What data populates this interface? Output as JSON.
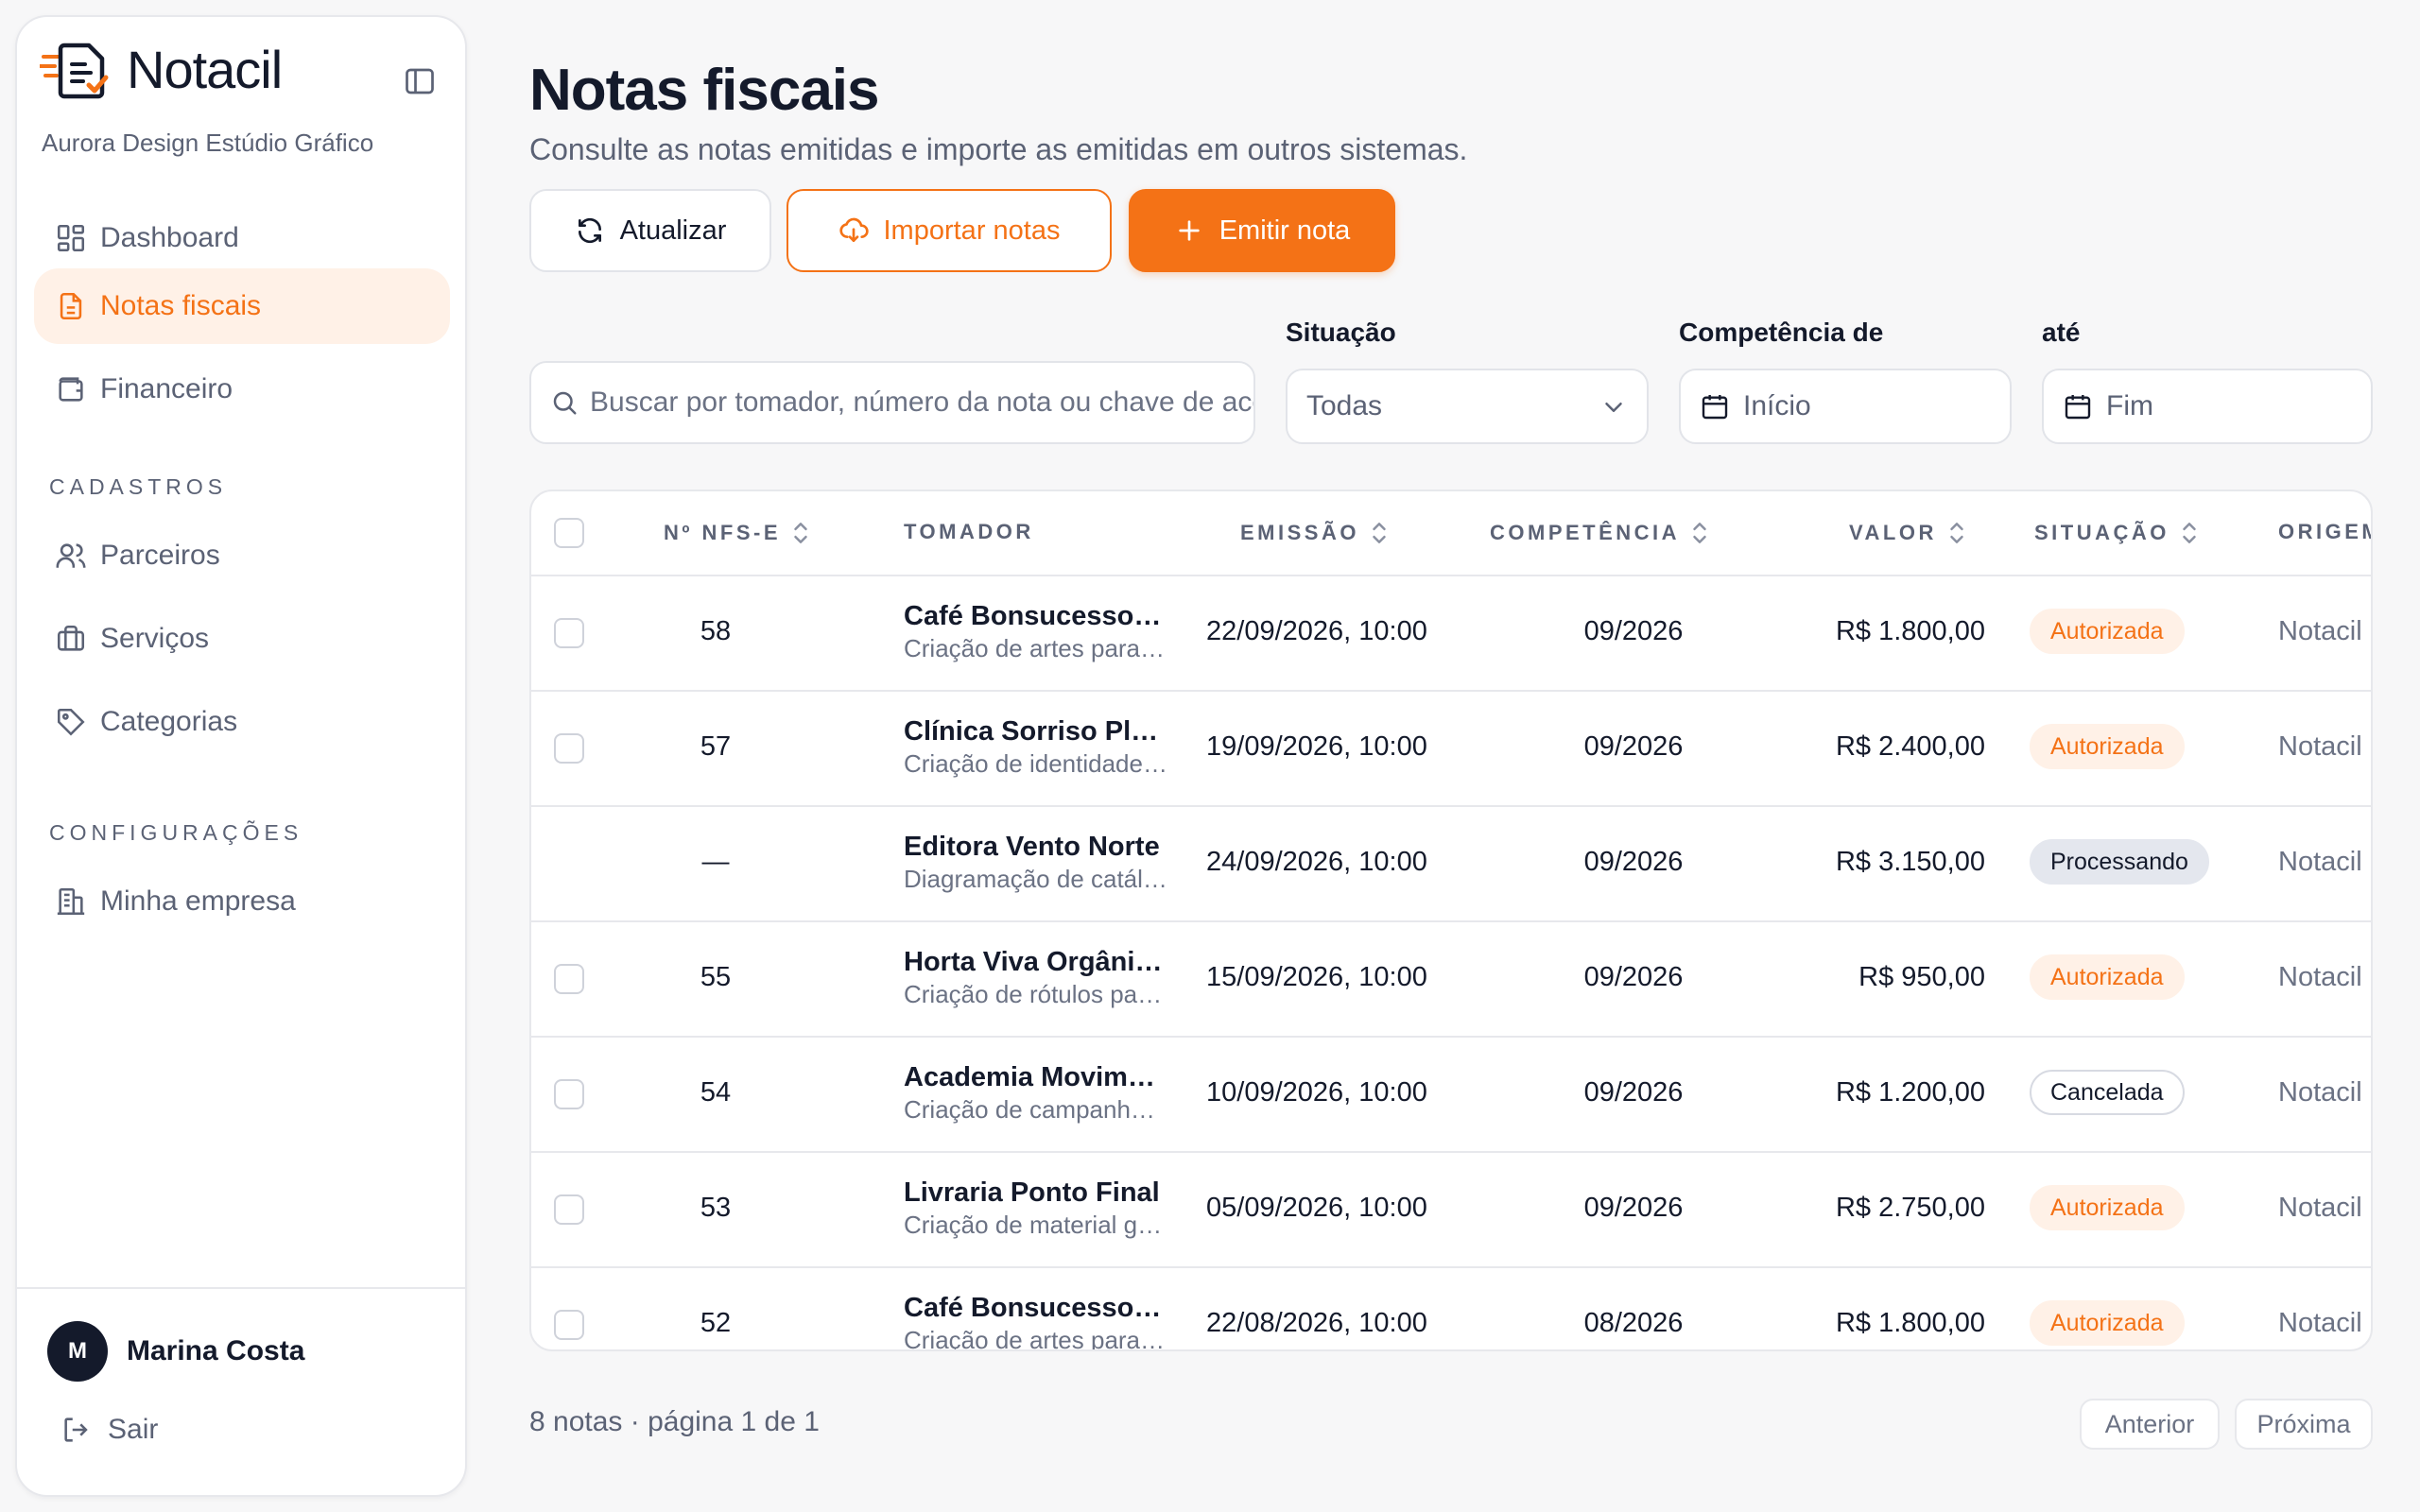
{
  "app": {
    "name": "Notacil",
    "company": "Aurora Design Estúdio Gráfico",
    "accent_color": "#f47216"
  },
  "sidebar": {
    "items": [
      {
        "label": "Dashboard",
        "icon": "dashboard-icon"
      },
      {
        "label": "Notas fiscais",
        "icon": "document-icon",
        "active": true
      },
      {
        "label": "Financeiro",
        "icon": "wallet-icon"
      }
    ],
    "section_cadastros": "CADASTROS",
    "cadastros": [
      {
        "label": "Parceiros",
        "icon": "users-icon"
      },
      {
        "label": "Serviços",
        "icon": "briefcase-icon"
      },
      {
        "label": "Categorias",
        "icon": "tag-icon"
      }
    ],
    "section_config": "CONFIGURAÇÕES",
    "config": [
      {
        "label": "Minha empresa",
        "icon": "building-icon"
      }
    ],
    "user": {
      "initial": "M",
      "name": "Marina Costa"
    },
    "logout_label": "Sair"
  },
  "header": {
    "title": "Notas fiscais",
    "subtitle": "Consulte as notas emitidas e importe as emitidas em outros sistemas."
  },
  "actions": {
    "refresh": "Atualizar",
    "import": "Importar notas",
    "emit": "Emitir nota"
  },
  "filters": {
    "search_placeholder": "Buscar por tomador, número da nota ou chave de acesso",
    "situacao_label": "Situação",
    "situacao_value": "Todas",
    "competencia_de_label": "Competência de",
    "competencia_de_value": "Início",
    "ate_label": "até",
    "ate_value": "Fim"
  },
  "table": {
    "columns": [
      "Nº NFS-E",
      "TOMADOR",
      "EMISSÃO",
      "COMPETÊNCIA",
      "VALOR",
      "SITUAÇÃO",
      "ORIGEM"
    ],
    "rows": [
      {
        "num": "58",
        "tomador": "Café Bonsucesso Ltda",
        "descricao": "Criação de artes para redes sociais",
        "emissao": "22/09/2026, 10:00",
        "competencia": "09/2026",
        "valor": "R$ 1.800,00",
        "situacao": "Autorizada",
        "origem": "Notacil",
        "checkbox": true
      },
      {
        "num": "57",
        "tomador": "Clínica Sorriso Pleno",
        "descricao": "Criação de identidade visual",
        "emissao": "19/09/2026, 10:00",
        "competencia": "09/2026",
        "valor": "R$ 2.400,00",
        "situacao": "Autorizada",
        "origem": "Notacil",
        "checkbox": true
      },
      {
        "num": "—",
        "tomador": "Editora Vento Norte",
        "descricao": "Diagramação de catálogo",
        "emissao": "24/09/2026, 10:00",
        "competencia": "09/2026",
        "valor": "R$ 3.150,00",
        "situacao": "Processando",
        "origem": "Notacil",
        "checkbox": false
      },
      {
        "num": "55",
        "tomador": "Horta Viva Orgânicos",
        "descricao": "Criação de rótulos para embalagens",
        "emissao": "15/09/2026, 10:00",
        "competencia": "09/2026",
        "valor": "R$ 950,00",
        "situacao": "Autorizada",
        "origem": "Notacil",
        "checkbox": true
      },
      {
        "num": "54",
        "tomador": "Academia Movimento",
        "descricao": "Criação de campanha publicitária",
        "emissao": "10/09/2026, 10:00",
        "competencia": "09/2026",
        "valor": "R$ 1.200,00",
        "situacao": "Cancelada",
        "origem": "Notacil",
        "checkbox": true
      },
      {
        "num": "53",
        "tomador": "Livraria Ponto Final",
        "descricao": "Criação de material gráfico",
        "emissao": "05/09/2026, 10:00",
        "competencia": "09/2026",
        "valor": "R$ 2.750,00",
        "situacao": "Autorizada",
        "origem": "Notacil",
        "checkbox": true
      },
      {
        "num": "52",
        "tomador": "Café Bonsucesso Ltda",
        "descricao": "Criação de artes para redes sociais",
        "emissao": "22/08/2026, 10:00",
        "competencia": "08/2026",
        "valor": "R$ 1.800,00",
        "situacao": "Autorizada",
        "origem": "Notacil",
        "checkbox": true
      }
    ]
  },
  "footer": {
    "count": "8 notas · página 1 de 1",
    "prev": "Anterior",
    "next": "Próxima"
  }
}
